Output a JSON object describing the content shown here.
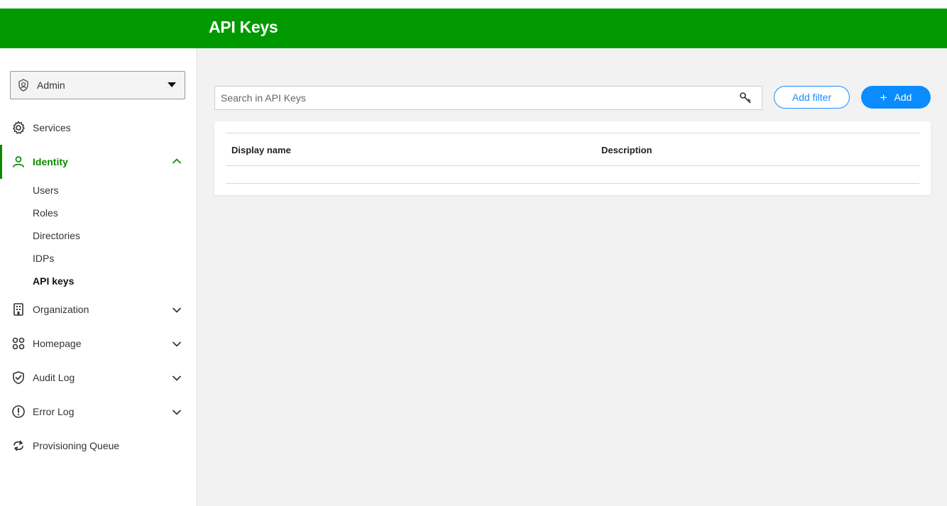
{
  "header": {
    "title": "API Keys"
  },
  "sidebar": {
    "context_select": {
      "value": "Admin"
    },
    "items": [
      {
        "label": "Services",
        "icon": "gear-icon"
      },
      {
        "label": "Identity",
        "icon": "person-icon",
        "expanded": true,
        "children": [
          "Users",
          "Roles",
          "Directories",
          "IDPs",
          "API keys"
        ],
        "selected_child": "API keys"
      },
      {
        "label": "Organization",
        "icon": "building-icon"
      },
      {
        "label": "Homepage",
        "icon": "grid-icon"
      },
      {
        "label": "Audit Log",
        "icon": "shield-check-icon"
      },
      {
        "label": "Error Log",
        "icon": "alert-circle-icon"
      },
      {
        "label": "Provisioning Queue",
        "icon": "sync-icon"
      }
    ]
  },
  "main": {
    "search": {
      "placeholder": "Search in API Keys",
      "value": ""
    },
    "add_filter_label": "Add filter",
    "add_label": "Add",
    "table": {
      "columns": [
        "Display name",
        "Description"
      ],
      "rows": []
    }
  },
  "colors": {
    "header_green": "#009900",
    "active_green": "#0a8a00",
    "accent_blue": "#0a8cff"
  }
}
